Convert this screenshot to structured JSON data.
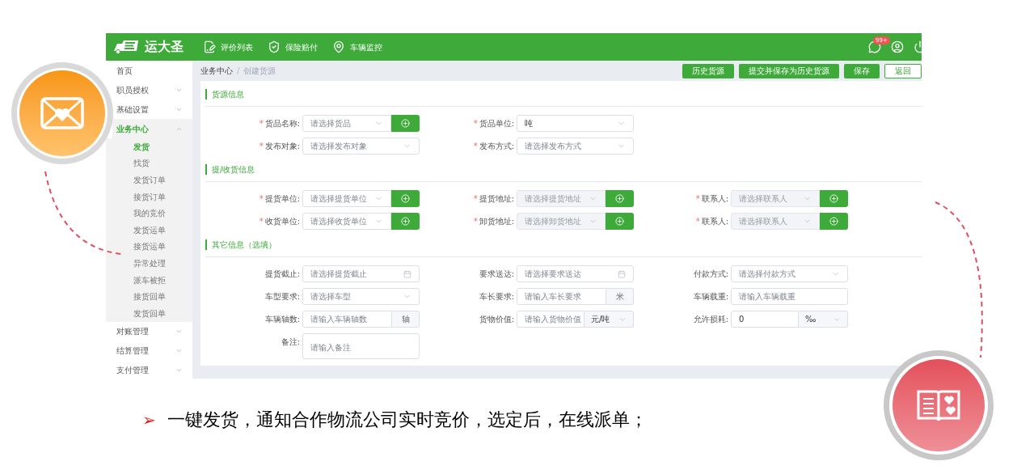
{
  "header": {
    "logo": "运大圣",
    "nav": [
      {
        "label": "评价列表",
        "kind": "review"
      },
      {
        "label": "保险赔付",
        "kind": "insurance"
      },
      {
        "label": "车辆监控",
        "kind": "location"
      }
    ],
    "badge": "99+"
  },
  "sidebar": {
    "items": [
      {
        "label": "首页",
        "kind": "link",
        "expanded": false,
        "selected": false
      },
      {
        "label": "职员授权",
        "kind": "group",
        "expanded": false,
        "selected": false
      },
      {
        "label": "基础设置",
        "kind": "group",
        "expanded": false,
        "selected": false
      },
      {
        "label": "业务中心",
        "kind": "group",
        "expanded": true,
        "selected": true,
        "children": [
          {
            "label": "发货",
            "selected": true
          },
          {
            "label": "找货",
            "selected": false
          },
          {
            "label": "发货订单",
            "selected": false
          },
          {
            "label": "接货订单",
            "selected": false
          },
          {
            "label": "我的竞价",
            "selected": false
          },
          {
            "label": "发货运单",
            "selected": false
          },
          {
            "label": "接货运单",
            "selected": false
          },
          {
            "label": "异常处理",
            "selected": false
          },
          {
            "label": "派车被拒",
            "selected": false
          },
          {
            "label": "接货回单",
            "selected": false
          },
          {
            "label": "发货回单",
            "selected": false
          }
        ]
      },
      {
        "label": "对账管理",
        "kind": "group",
        "expanded": false,
        "selected": false
      },
      {
        "label": "结算管理",
        "kind": "group",
        "expanded": false,
        "selected": false
      },
      {
        "label": "支付管理",
        "kind": "group",
        "expanded": false,
        "selected": false
      }
    ]
  },
  "breadcrumb": [
    "业务中心",
    "创建货源"
  ],
  "breadcrumb_separator": "/",
  "required_mark": "*",
  "actions": [
    {
      "label": "历史货源",
      "kind": "primary"
    },
    {
      "label": "提交并保存为历史货源",
      "kind": "primary"
    },
    {
      "label": "保存",
      "kind": "primary"
    },
    {
      "label": "返回",
      "kind": "outline"
    }
  ],
  "sections": [
    {
      "title": "货源信息",
      "rows": [
        [
          {
            "label": "货品名称:",
            "required": true,
            "kind": "select",
            "placeholder": "请选择货品",
            "action": {
              "kind": "add"
            },
            "disabled": false
          },
          {
            "label": "货品单位:",
            "required": true,
            "kind": "select",
            "value": "吨",
            "disabled": false
          }
        ],
        [
          {
            "label": "发布对象:",
            "required": true,
            "kind": "select",
            "placeholder": "请选择发布对象",
            "disabled": false
          },
          {
            "label": "发布方式:",
            "required": true,
            "kind": "select",
            "placeholder": "请选择发布方式",
            "disabled": false
          }
        ]
      ]
    },
    {
      "title": "提/收货信息",
      "rows": [
        [
          {
            "label": "提货单位:",
            "required": true,
            "kind": "select",
            "placeholder": "请选择提货单位",
            "action": {
              "kind": "add"
            },
            "disabled": false
          },
          {
            "label": "提货地址:",
            "required": true,
            "kind": "select",
            "placeholder": "请选择提货地址",
            "action": {
              "kind": "add"
            },
            "disabled": true
          },
          {
            "label": "联系人:",
            "required": true,
            "kind": "select",
            "placeholder": "请选择联系人",
            "action": {
              "kind": "add"
            },
            "disabled": true
          }
        ],
        [
          {
            "label": "收货单位:",
            "required": true,
            "kind": "select",
            "placeholder": "请选择收货单位",
            "action": {
              "kind": "add"
            },
            "disabled": false
          },
          {
            "label": "卸货地址:",
            "required": true,
            "kind": "select",
            "placeholder": "请选择卸货地址",
            "action": {
              "kind": "add"
            },
            "disabled": true
          },
          {
            "label": "联系人:",
            "required": true,
            "kind": "select",
            "placeholder": "请选择联系人",
            "action": {
              "kind": "add"
            },
            "disabled": true
          }
        ]
      ]
    },
    {
      "title": "其它信息（选填）",
      "rows": [
        [
          {
            "label": "提货截止:",
            "required": false,
            "kind": "date",
            "placeholder": "请选择提货截止",
            "disabled": false
          },
          {
            "label": "要求送达:",
            "required": false,
            "kind": "date",
            "placeholder": "请选择要求送达",
            "disabled": false
          },
          {
            "label": "付款方式:",
            "required": false,
            "kind": "select",
            "placeholder": "请选择付款方式",
            "disabled": false
          }
        ],
        [
          {
            "label": "车型要求:",
            "required": false,
            "kind": "select",
            "placeholder": "请选择车型",
            "disabled": false
          },
          {
            "label": "车长要求:",
            "required": false,
            "kind": "input",
            "placeholder": "请输入车长要求",
            "suffix": "米",
            "disabled": false
          },
          {
            "label": "车辆载重:",
            "required": false,
            "kind": "input",
            "placeholder": "请输入车辆载重",
            "disabled": false
          }
        ],
        [
          {
            "label": "车辆轴数:",
            "required": false,
            "kind": "input",
            "placeholder": "请输入车辆轴数",
            "suffix": "轴",
            "disabled": false
          },
          {
            "label": "货物价值:",
            "required": false,
            "kind": "input",
            "placeholder": "请输入货物价值",
            "unit": "元/吨",
            "disabled": false
          },
          {
            "label": "允许损耗:",
            "required": false,
            "kind": "input",
            "value": "0",
            "unit": "‰",
            "disabled": false
          }
        ],
        [
          {
            "label": "备注:",
            "required": false,
            "kind": "textarea",
            "placeholder": "请输入备注"
          }
        ]
      ]
    }
  ],
  "bullet": {
    "marker": "➢",
    "text": "一键发货，通知合作物流公司实时竞价，选定后，在线派单；"
  }
}
